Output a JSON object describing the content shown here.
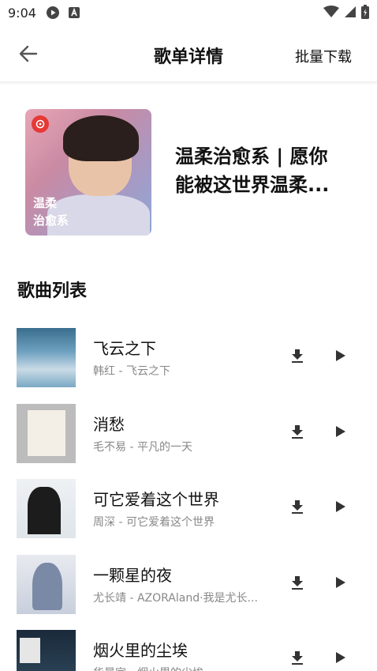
{
  "status_bar": {
    "time": "9:04",
    "icons": [
      "play-circle-icon",
      "font-a-icon",
      "wifi-icon",
      "signal-icon",
      "battery-icon"
    ]
  },
  "app_bar": {
    "title": "歌单详情",
    "back_icon": "arrow-left-icon",
    "batch_download_label": "批量下载"
  },
  "playlist": {
    "cover_caption": "温柔\n治愈系",
    "name": "温柔治愈系 | 愿你\n能被这世界温柔..."
  },
  "song_section": {
    "title": "歌曲列表",
    "songs": [
      {
        "name": "飞云之下",
        "subtitle": "韩红 - 飞云之下"
      },
      {
        "name": "消愁",
        "subtitle": "毛不易 - 平凡的一天"
      },
      {
        "name": "可它爱着这个世界",
        "subtitle": "周深 - 可它爱着这个世界"
      },
      {
        "name": "一颗星的夜",
        "subtitle": "尤长靖 - AZORAland·我是尤长..."
      },
      {
        "name": "烟火里的尘埃",
        "subtitle": "华晨宇 - 烟火里的尘埃"
      }
    ]
  },
  "colors": {
    "text_primary": "#111111",
    "text_secondary": "#888888",
    "icon": "#333333",
    "brand_red": "#e53935"
  }
}
